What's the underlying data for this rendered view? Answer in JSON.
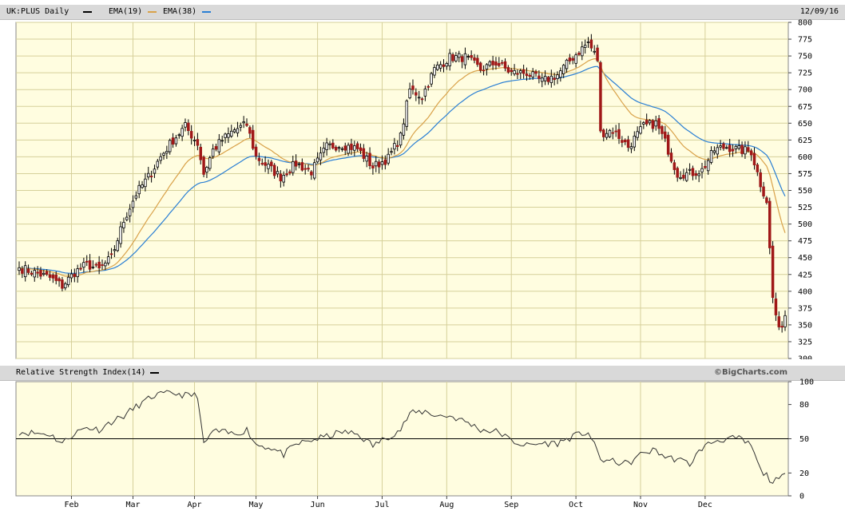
{
  "header": {
    "symbol_label": "UK:PLUS Daily",
    "ema1_label": "EMA(19)",
    "ema2_label": "EMA(38)",
    "date": "12/09/16",
    "colors": {
      "price": "#000000",
      "ema1": "#d9a24a",
      "ema2": "#2a7fd4"
    }
  },
  "rsi_header": {
    "label": "Relative Strength Index(14)",
    "watermark": "©BigCharts.com"
  },
  "colors": {
    "plot_bg": "#fffde0",
    "grid": "#d6d09a",
    "up_candle": "#ffffff",
    "down_candle": "#a01818",
    "rsi_line": "#333333"
  },
  "chart_data": [
    {
      "type": "candlestick",
      "title": "UK:PLUS Daily",
      "x_tick_labels": [
        "Feb",
        "Mar",
        "Apr",
        "May",
        "Jun",
        "Jul",
        "Aug",
        "Sep",
        "Oct",
        "Nov",
        "Dec"
      ],
      "y_range": [
        300,
        800
      ],
      "y_ticks": [
        300,
        325,
        350,
        375,
        400,
        425,
        450,
        475,
        500,
        525,
        550,
        575,
        600,
        625,
        650,
        675,
        700,
        725,
        750,
        775,
        800
      ],
      "grid": true,
      "anchors_close": [
        [
          0,
          435
        ],
        [
          5,
          428
        ],
        [
          10,
          420
        ],
        [
          14,
          408
        ],
        [
          18,
          428
        ],
        [
          22,
          440
        ],
        [
          26,
          432
        ],
        [
          30,
          450
        ],
        [
          34,
          505
        ],
        [
          38,
          545
        ],
        [
          42,
          570
        ],
        [
          46,
          600
        ],
        [
          50,
          625
        ],
        [
          54,
          645
        ],
        [
          58,
          620
        ],
        [
          60,
          575
        ],
        [
          63,
          610
        ],
        [
          66,
          625
        ],
        [
          70,
          640
        ],
        [
          74,
          648
        ],
        [
          77,
          600
        ],
        [
          81,
          585
        ],
        [
          85,
          570
        ],
        [
          90,
          590
        ],
        [
          95,
          578
        ],
        [
          100,
          615
        ],
        [
          105,
          618
        ],
        [
          110,
          612
        ],
        [
          115,
          585
        ],
        [
          120,
          598
        ],
        [
          124,
          630
        ],
        [
          127,
          700
        ],
        [
          131,
          690
        ],
        [
          135,
          730
        ],
        [
          140,
          748
        ],
        [
          145,
          748
        ],
        [
          150,
          730
        ],
        [
          155,
          740
        ],
        [
          160,
          725
        ],
        [
          165,
          725
        ],
        [
          170,
          712
        ],
        [
          175,
          722
        ],
        [
          180,
          748
        ],
        [
          185,
          770
        ],
        [
          188,
          745
        ],
        [
          189,
          635
        ],
        [
          193,
          640
        ],
        [
          198,
          615
        ],
        [
          203,
          645
        ],
        [
          207,
          650
        ],
        [
          210,
          622
        ],
        [
          214,
          575
        ],
        [
          218,
          575
        ],
        [
          222,
          580
        ],
        [
          226,
          610
        ],
        [
          230,
          615
        ],
        [
          234,
          610
        ],
        [
          238,
          608
        ],
        [
          241,
          560
        ],
        [
          243,
          535
        ],
        [
          245,
          390
        ],
        [
          247,
          340
        ],
        [
          249,
          365
        ]
      ],
      "series": [
        {
          "name": "UK:PLUS Daily",
          "kind": "candles"
        },
        {
          "name": "EMA(19)",
          "kind": "line",
          "period": 19
        },
        {
          "name": "EMA(38)",
          "kind": "line",
          "period": 38
        }
      ]
    },
    {
      "type": "line",
      "title": "Relative Strength Index(14)",
      "y_range": [
        0,
        100
      ],
      "y_ticks": [
        0,
        20,
        50,
        80,
        100
      ],
      "reference_line": 50,
      "x_tick_labels": [
        "Feb",
        "Mar",
        "Apr",
        "May",
        "Jun",
        "Jul",
        "Aug",
        "Sep",
        "Oct",
        "Nov",
        "Dec"
      ],
      "anchors": [
        [
          0,
          56
        ],
        [
          10,
          54
        ],
        [
          14,
          46
        ],
        [
          18,
          55
        ],
        [
          22,
          60
        ],
        [
          26,
          58
        ],
        [
          30,
          65
        ],
        [
          34,
          70
        ],
        [
          38,
          78
        ],
        [
          44,
          88
        ],
        [
          50,
          90
        ],
        [
          54,
          88
        ],
        [
          58,
          88
        ],
        [
          60,
          44
        ],
        [
          63,
          57
        ],
        [
          70,
          54
        ],
        [
          74,
          58
        ],
        [
          77,
          45
        ],
        [
          82,
          42
        ],
        [
          86,
          36
        ],
        [
          90,
          45
        ],
        [
          94,
          48
        ],
        [
          100,
          52
        ],
        [
          105,
          56
        ],
        [
          110,
          54
        ],
        [
          115,
          44
        ],
        [
          120,
          52
        ],
        [
          124,
          58
        ],
        [
          127,
          72
        ],
        [
          132,
          74
        ],
        [
          136,
          70
        ],
        [
          140,
          70
        ],
        [
          146,
          64
        ],
        [
          150,
          58
        ],
        [
          156,
          56
        ],
        [
          160,
          48
        ],
        [
          165,
          44
        ],
        [
          170,
          46
        ],
        [
          175,
          46
        ],
        [
          180,
          52
        ],
        [
          185,
          56
        ],
        [
          189,
          32
        ],
        [
          193,
          30
        ],
        [
          198,
          28
        ],
        [
          203,
          38
        ],
        [
          207,
          40
        ],
        [
          210,
          34
        ],
        [
          214,
          32
        ],
        [
          218,
          28
        ],
        [
          222,
          42
        ],
        [
          226,
          48
        ],
        [
          230,
          50
        ],
        [
          234,
          50
        ],
        [
          238,
          44
        ],
        [
          241,
          22
        ],
        [
          243,
          18
        ],
        [
          245,
          12
        ],
        [
          247,
          14
        ],
        [
          249,
          18
        ]
      ]
    }
  ]
}
